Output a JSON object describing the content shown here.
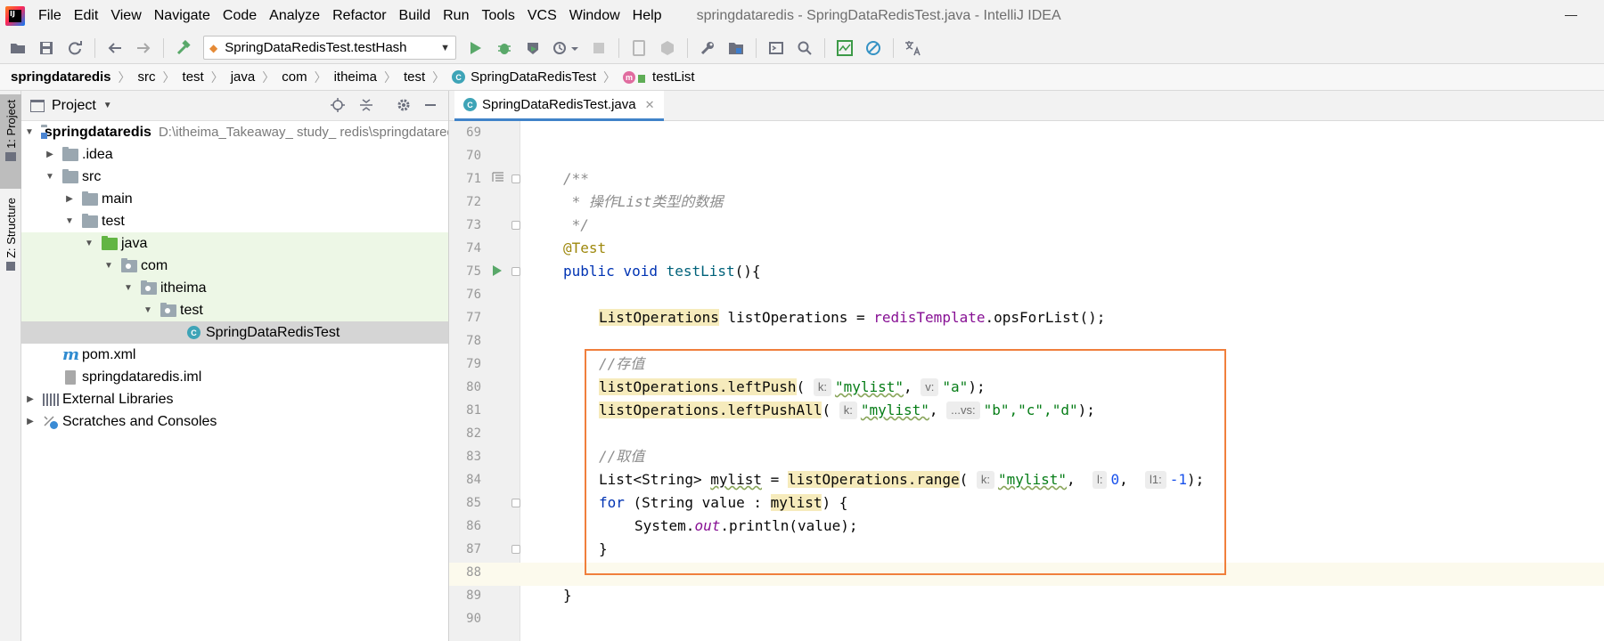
{
  "menu": {
    "app_logo_text": "IJ",
    "items": [
      "File",
      "Edit",
      "View",
      "Navigate",
      "Code",
      "Analyze",
      "Refactor",
      "Build",
      "Run",
      "Tools",
      "VCS",
      "Window",
      "Help"
    ],
    "window_title": "springdataredis - SpringDataRedisTest.java - IntelliJ IDEA"
  },
  "toolbar": {
    "run_config": "SpringDataRedisTest.testHash",
    "icons": [
      "open-folder-icon",
      "save-all-icon",
      "sync-icon",
      "back-arrow-icon",
      "forward-arrow-icon",
      "build-hammer-icon",
      "run-icon",
      "debug-icon",
      "coverage-icon",
      "profile-icon",
      "stop-icon",
      "device-icon",
      "device-disabled-icon",
      "wrench-icon",
      "project-structure-icon",
      "terminal-icon",
      "search-icon",
      "statistic-icon",
      "disable-icon",
      "translate-icon"
    ]
  },
  "breadcrumb": {
    "items": [
      "springdataredis",
      "src",
      "test",
      "java",
      "com",
      "itheima",
      "test",
      "SpringDataRedisTest",
      "testList"
    ]
  },
  "side_tabs": {
    "project": "1: Project",
    "structure": "Z: Structure"
  },
  "project_panel": {
    "title": "Project",
    "tree": [
      {
        "label": "springdataredis",
        "hint": "D:\\itheima_Takeaway_ study_ redis\\springdataredis",
        "depth": 0,
        "expanded": true,
        "icon": "module-folder"
      },
      {
        "label": ".idea",
        "depth": 1,
        "expanded": false,
        "icon": "folder"
      },
      {
        "label": "src",
        "depth": 1,
        "expanded": true,
        "icon": "folder"
      },
      {
        "label": "main",
        "depth": 2,
        "expanded": false,
        "icon": "folder"
      },
      {
        "label": "test",
        "depth": 2,
        "expanded": true,
        "icon": "folder"
      },
      {
        "label": "java",
        "depth": 3,
        "expanded": true,
        "icon": "test-source-folder"
      },
      {
        "label": "com",
        "depth": 4,
        "expanded": true,
        "icon": "package"
      },
      {
        "label": "itheima",
        "depth": 5,
        "expanded": true,
        "icon": "package"
      },
      {
        "label": "test",
        "depth": 6,
        "expanded": true,
        "icon": "package"
      },
      {
        "label": "SpringDataRedisTest",
        "depth": 7,
        "icon": "class"
      },
      {
        "label": "pom.xml",
        "depth": 1,
        "icon": "maven"
      },
      {
        "label": "springdataredis.iml",
        "depth": 1,
        "icon": "iml"
      },
      {
        "label": "External Libraries",
        "depth": 0,
        "expanded": false,
        "icon": "libraries"
      },
      {
        "label": "Scratches and Consoles",
        "depth": 0,
        "expanded": false,
        "icon": "scratches"
      }
    ]
  },
  "editor": {
    "tab_label": "SpringDataRedisTest.java",
    "line_numbers": [
      "69",
      "70",
      "71",
      "72",
      "73",
      "74",
      "75",
      "76",
      "77",
      "78",
      "79",
      "80",
      "81",
      "82",
      "83",
      "84",
      "85",
      "86",
      "87",
      "88",
      "89",
      "90"
    ],
    "code": {
      "l71": "/**",
      "l72": " * 操作List类型的数据",
      "l73": " */",
      "l74": "@Test",
      "l75_kw": "public void ",
      "l75_fn": "testList",
      "l75_rest": "(){",
      "l77_type": "ListOperations",
      "l77_mid": " listOperations = ",
      "l77_field": "redisTemplate",
      "l77_rest": ".opsForList();",
      "l79": "//存值",
      "l80_call": "listOperations.leftPush",
      "l80_hint1": "k:",
      "l80_arg1": "\"mylist\"",
      "l80_hint2": "v:",
      "l80_arg2": "\"a\"",
      "l81_call": "listOperations.leftPushAll",
      "l81_hint1": "k:",
      "l81_arg1": "\"mylist\"",
      "l81_hint2": "...vs:",
      "l81_args": "\"b\",\"c\",\"d\"",
      "l83": "//取值",
      "l84_start": "List<String> ",
      "l84_var": "mylist",
      "l84_eq": " = ",
      "l84_call": "listOperations.range",
      "l84_hint1": "k:",
      "l84_arg1": "\"mylist\"",
      "l84_hint2": "l:",
      "l84_arg2": "0",
      "l84_hint3": "l1:",
      "l84_arg3": "-1",
      "l85_kw": "for",
      "l85_mid": " (String value : ",
      "l85_var": "mylist",
      "l85_rest": ") {",
      "l86_start": "System.",
      "l86_out": "out",
      "l86_rest": ".println(value);",
      "l87": "}",
      "l89": "}"
    }
  },
  "colors": {
    "highlight_box": "#f07f3c",
    "keyword": "#0033b3",
    "string": "#067d17",
    "annotation": "#9e880d",
    "comment": "#8c8c8c"
  }
}
